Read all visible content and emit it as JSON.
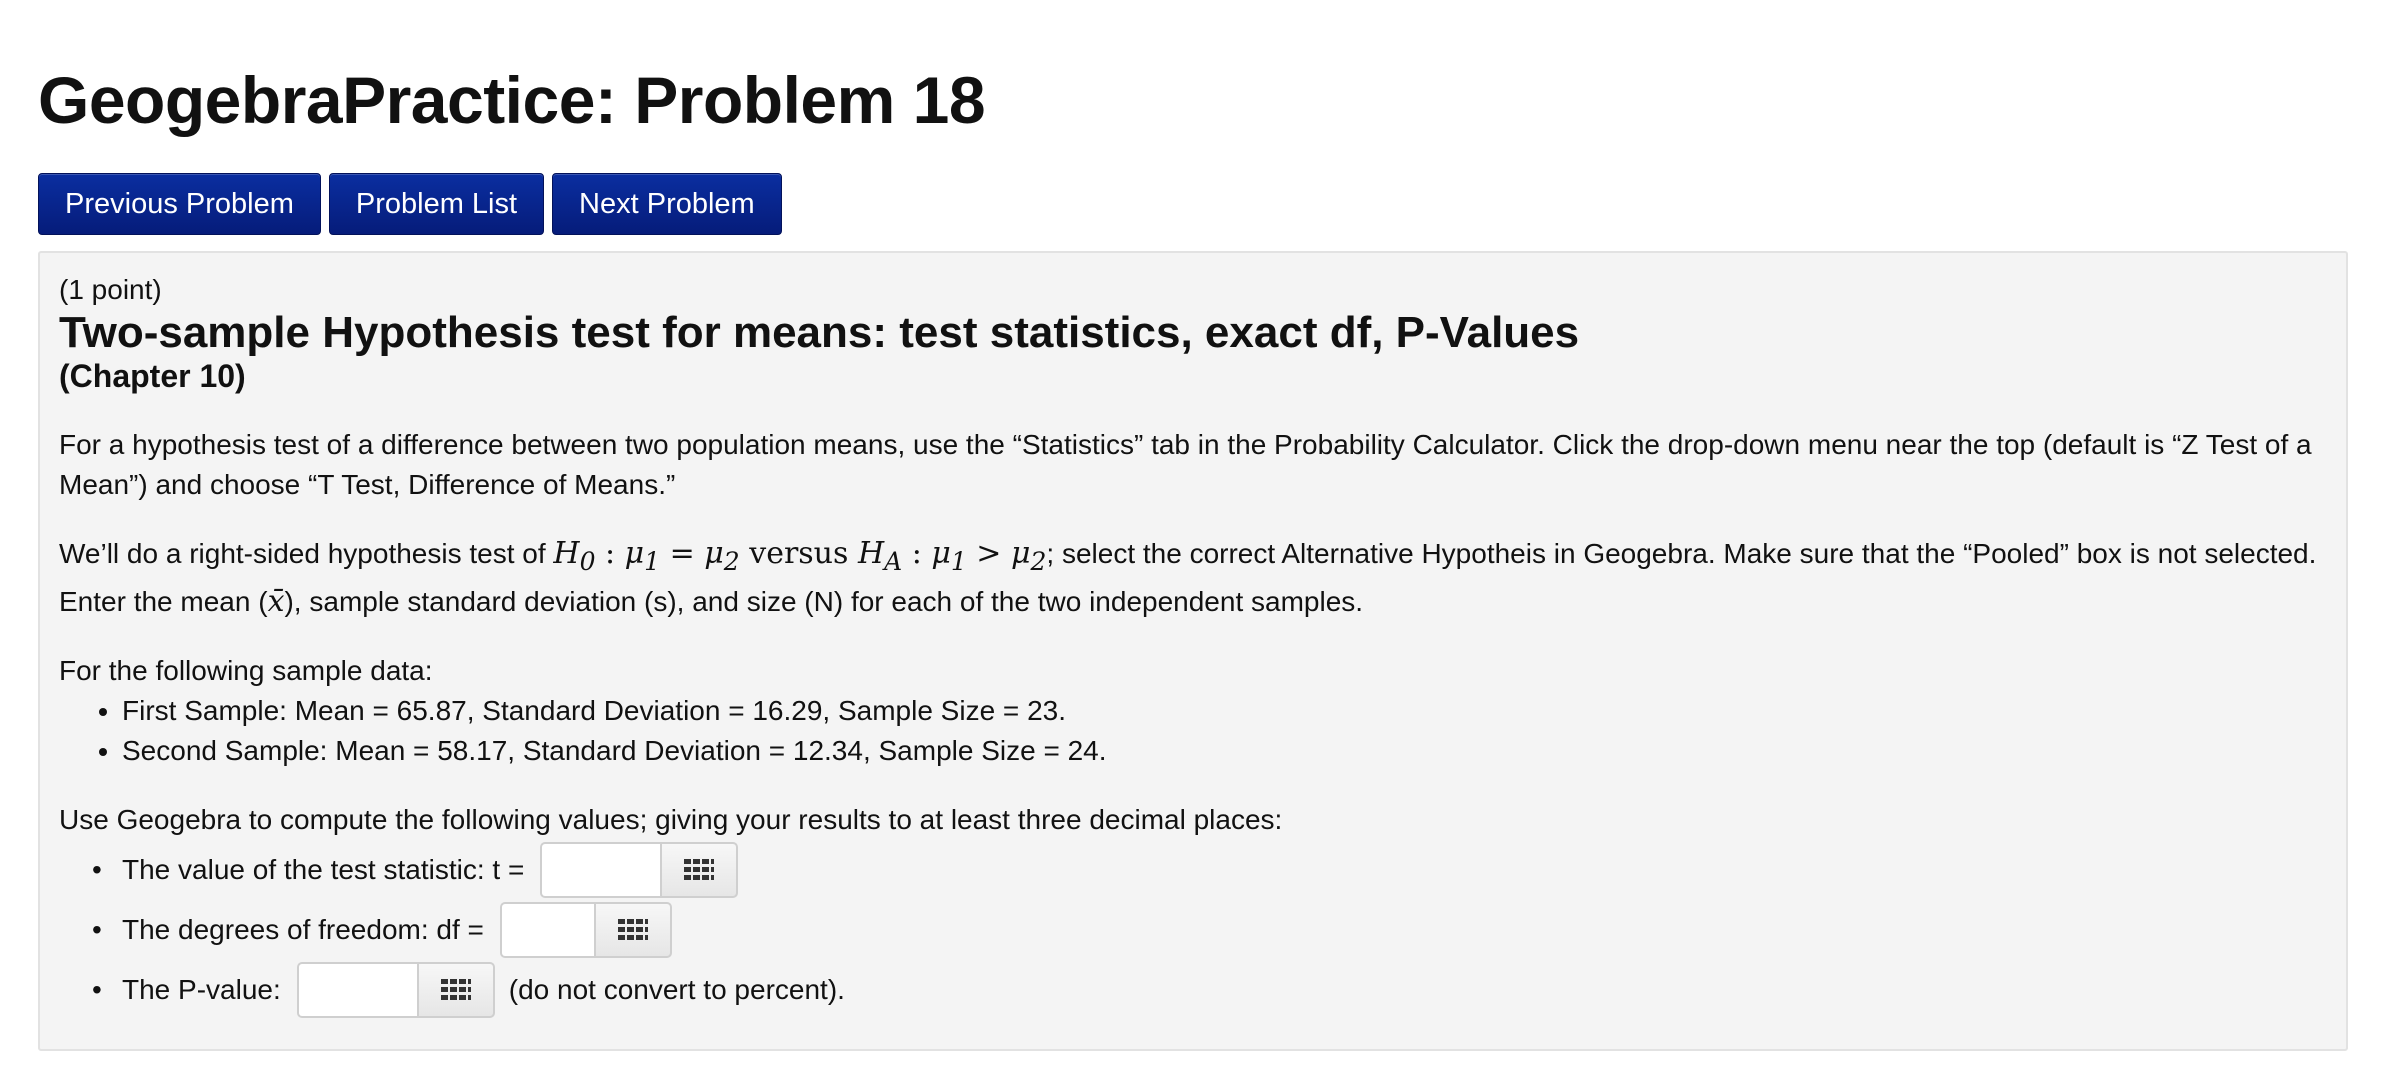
{
  "page": {
    "title": "GeogebraPractice: Problem 18"
  },
  "nav": {
    "previous": "Previous Problem",
    "list": "Problem List",
    "next": "Next Problem",
    "button_color": "#061c7a"
  },
  "problem": {
    "points": "(1 point)",
    "title": "Two-sample Hypothesis test for means: test statistics, exact df, P-Values",
    "chapter": "(Chapter 10)",
    "paragraph1": "For a hypothesis test of a difference between two population means, use the “Statistics” tab in the Probability Calculator. Click the drop-down menu near the top (default is “Z Test of a Mean”) and choose “T Test, Difference of Means.”",
    "paragraph2_before": "We’ll do a right-sided hypothesis test of ",
    "paragraph2_math": {
      "h0": "H",
      "h0_sub": "0",
      "colon": " : ",
      "mu": "μ",
      "sub1": "1",
      "sub2": "2",
      "equals": " = ",
      "versus": " versus ",
      "ha_sub": "A",
      "greater": " > "
    },
    "paragraph2_after": "; select the correct Alternative Hypotheis in Geogebra. Make sure that the “Pooled” box is not selected. Enter the mean (",
    "xbar": "x̄",
    "paragraph2_end": "), sample standard deviation (s), and size (N) for each of the two independent samples.",
    "data_intro": "For the following sample data:",
    "samples": [
      "First Sample: Mean = 65.87, Standard Deviation = 16.29, Sample Size = 23.",
      "Second Sample: Mean = 58.17, Standard Deviation = 12.34, Sample Size = 24."
    ],
    "compute_intro": "Use Geogebra to compute the following values; giving your results to at least three decimal places:",
    "answers": [
      {
        "label": "The value of the test statistic: t =",
        "value": "",
        "suffix": ""
      },
      {
        "label": "The degrees of freedom: df =",
        "value": "",
        "suffix": ""
      },
      {
        "label": "The P-value:",
        "value": "",
        "suffix": "(do not convert to percent)."
      }
    ],
    "keyboard_icon": "keypad-grid-icon"
  }
}
